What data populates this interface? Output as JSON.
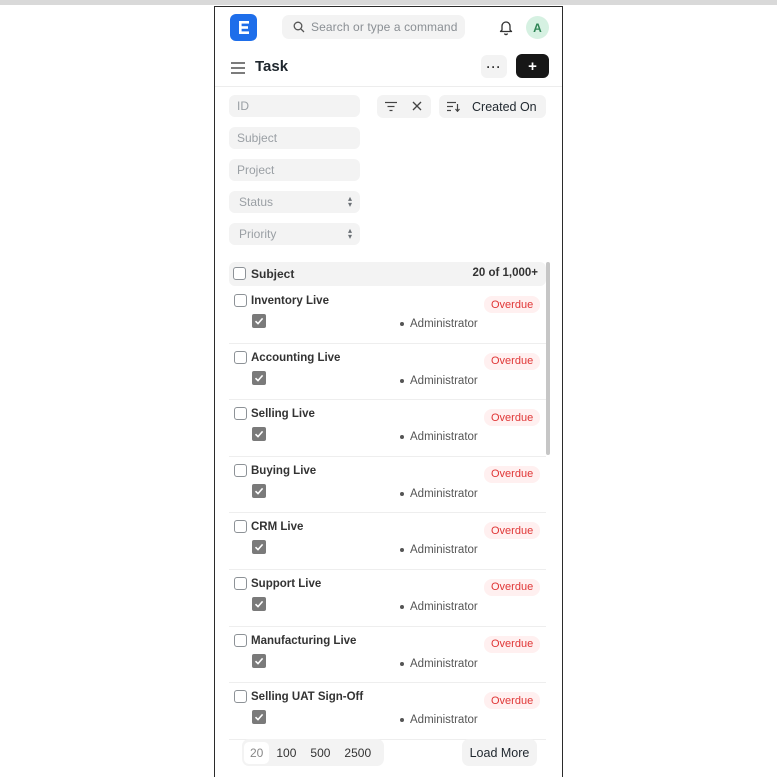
{
  "navbar": {
    "search_placeholder": "Search or type a command",
    "avatar_initial": "A"
  },
  "page": {
    "title": "Task",
    "more_label": "···",
    "add_label": "+"
  },
  "filters": {
    "id_placeholder": "ID",
    "subject_placeholder": "Subject",
    "project_placeholder": "Project",
    "status_placeholder": "Status",
    "priority_placeholder": "Priority",
    "sort_label": "Created On"
  },
  "list": {
    "header_label": "Subject",
    "count": "20 of 1,000+",
    "rows": [
      {
        "subject": "Inventory Live",
        "status": "Overdue",
        "owner": "Administrator"
      },
      {
        "subject": "Accounting Live",
        "status": "Overdue",
        "owner": "Administrator"
      },
      {
        "subject": "Selling Live",
        "status": "Overdue",
        "owner": "Administrator"
      },
      {
        "subject": "Buying Live",
        "status": "Overdue",
        "owner": "Administrator"
      },
      {
        "subject": "CRM Live",
        "status": "Overdue",
        "owner": "Administrator"
      },
      {
        "subject": "Support Live",
        "status": "Overdue",
        "owner": "Administrator"
      },
      {
        "subject": "Manufacturing Live",
        "status": "Overdue",
        "owner": "Administrator"
      },
      {
        "subject": "Selling UAT Sign-Off",
        "status": "Overdue",
        "owner": "Administrator"
      }
    ]
  },
  "footer": {
    "page_sizes": [
      "20",
      "100",
      "500",
      "2500"
    ],
    "load_more": "Load More"
  },
  "colors": {
    "brand": "#1e6eea",
    "overdue_text": "#e03636",
    "overdue_bg": "#fff0f0"
  }
}
